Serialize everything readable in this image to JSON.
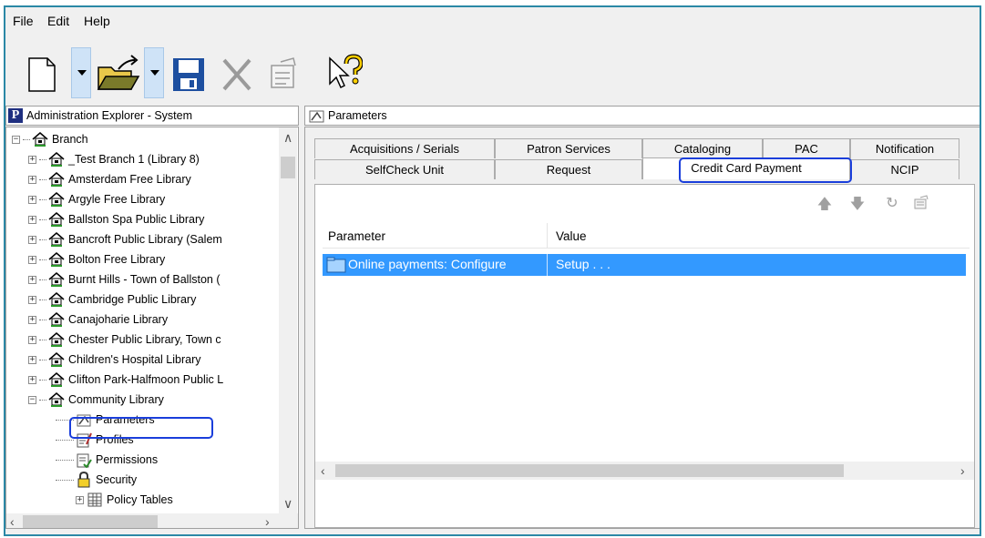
{
  "menu": {
    "file": "File",
    "edit": "Edit",
    "help": "Help"
  },
  "toolbar": {
    "icons": [
      "new-document-icon",
      "open-folder-icon",
      "save-icon",
      "delete-icon",
      "properties-icon",
      "help-pointer-icon"
    ]
  },
  "left_pane": {
    "title": "Administration Explorer - System",
    "logo_letter": "P",
    "tree": [
      {
        "label": "Branch",
        "expander": "−"
      },
      {
        "label": "_Test Branch 1 (Library 8)",
        "expander": "+"
      },
      {
        "label": "Amsterdam Free Library",
        "expander": "+"
      },
      {
        "label": "Argyle Free Library",
        "expander": "+"
      },
      {
        "label": "Ballston Spa Public Library",
        "expander": "+"
      },
      {
        "label": "Bancroft Public Library (Salem",
        "expander": "+"
      },
      {
        "label": "Bolton Free Library",
        "expander": "+"
      },
      {
        "label": "Burnt Hills - Town of Ballston (",
        "expander": "+"
      },
      {
        "label": "Cambridge Public Library",
        "expander": "+"
      },
      {
        "label": "Canajoharie Library",
        "expander": "+"
      },
      {
        "label": "Chester Public Library, Town c",
        "expander": "+"
      },
      {
        "label": "Children's Hospital Library",
        "expander": "+"
      },
      {
        "label": "Clifton Park-Halfmoon Public L",
        "expander": "+"
      },
      {
        "label": "Community Library",
        "expander": "−"
      },
      {
        "label": "Parameters"
      },
      {
        "label": "Profiles"
      },
      {
        "label": "Permissions"
      },
      {
        "label": "Security"
      },
      {
        "label": "Policy Tables",
        "expander": "+"
      }
    ]
  },
  "right_pane": {
    "title": "Parameters",
    "tabs_row1": [
      "Acquisitions / Serials",
      "Patron Services",
      "Cataloging",
      "PAC",
      "Notification"
    ],
    "tabs_row2": [
      "SelfCheck Unit",
      "Request",
      "Credit Card Payment",
      "NCIP"
    ],
    "active_tab": "Credit Card Payment",
    "grid": {
      "columns": [
        "Parameter",
        "Value"
      ],
      "rows": [
        {
          "parameter": "Online payments: Configure",
          "value": "Setup . . ."
        }
      ]
    }
  },
  "colors": {
    "selection": "#3399ff",
    "highlight_box": "#1a3edb",
    "window_border": "#2b88a6"
  }
}
